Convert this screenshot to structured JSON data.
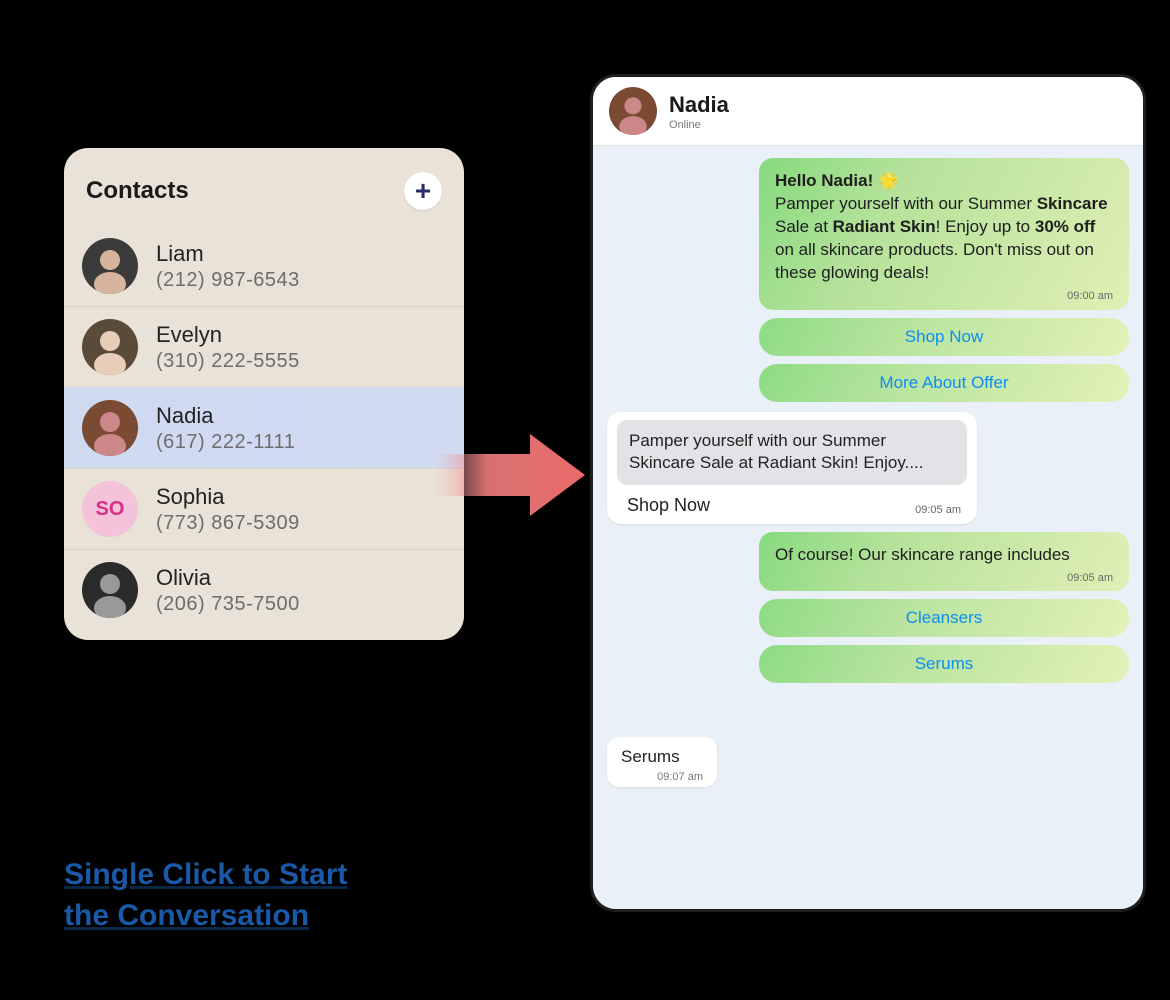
{
  "contacts": {
    "title": "Contacts",
    "items": [
      {
        "name": "Liam",
        "phone": "(212) 987-6543",
        "avatar": "photo-m1",
        "selected": false
      },
      {
        "name": "Evelyn",
        "phone": "(310) 222-5555",
        "avatar": "photo-f1",
        "selected": false
      },
      {
        "name": "Nadia",
        "phone": "(617) 222-1111",
        "avatar": "photo-f2",
        "selected": true
      },
      {
        "name": "Sophia",
        "phone": "(773) 867-5309",
        "avatar": "initials-SO",
        "selected": false,
        "avatar_bg": "#f4c3da",
        "avatar_fg": "#d63384",
        "initials": "SO"
      },
      {
        "name": "Olivia",
        "phone": "(206) 735-7500",
        "avatar": "photo-f3",
        "selected": false
      }
    ]
  },
  "chat": {
    "name": "Nadia",
    "status": "Online",
    "messages": [
      {
        "type": "sent",
        "html": "<b>Hello Nadia!</b> 🌟<br>Pamper yourself with our Summer <b>Skincare</b> Sale at <b>Radiant Skin</b>! Enjoy up to <b>30% off</b> on all skincare products. Don't miss out on these glowing deals!",
        "time": "09:00 am",
        "actions": [
          "Shop Now",
          "More About Offer"
        ]
      },
      {
        "type": "received",
        "quoted": "Pamper yourself with our Summer Skincare Sale at Radiant Skin! Enjoy....",
        "label": "Shop Now",
        "time": "09:05 am"
      },
      {
        "type": "sent",
        "html": "Of course! Our skincare range includes",
        "time": "09:05 am",
        "actions": [
          "Cleansers",
          "Serums"
        ]
      },
      {
        "type": "received_small",
        "label": "Serums",
        "time": "09:07 am"
      }
    ]
  },
  "caption": {
    "line1": "Single Click to Start",
    "line2": "the Conversation"
  },
  "colors": {
    "link": "#0d8df2",
    "caption": "#1a59a7",
    "contacts_bg": "#e9e2d6",
    "chat_bg": "#e9f0f7"
  }
}
